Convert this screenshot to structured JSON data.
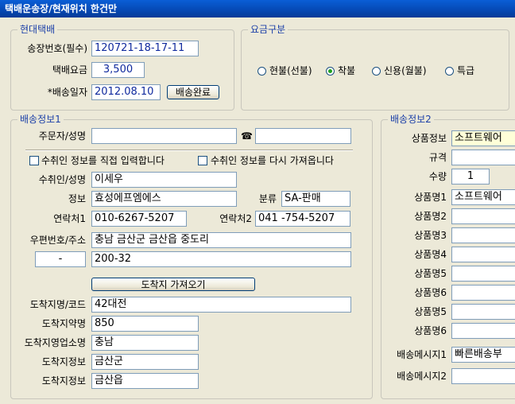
{
  "window": {
    "title": "택배운송장/현재위치 한건만"
  },
  "courier_group": {
    "title": "현대택배",
    "invoice_label": "송장번호(필수)",
    "invoice_value": "120721-18-17-11",
    "fee_label": "택배요금",
    "fee_value": "3,500",
    "date_label": "*배송일자",
    "date_value": "2012.08.10",
    "complete_button": "배송완료"
  },
  "fee_type_group": {
    "title": "요금구분",
    "options": [
      "현불(선불)",
      "착불",
      "신용(월불)",
      "특급"
    ],
    "selected": "착불"
  },
  "delivery_info1": {
    "title": "배송정보1",
    "orderer_label": "주문자/성명",
    "orderer_value": "",
    "phone_icon": "☎",
    "phone_value": "",
    "chk_direct_label": "수취인 정보를 직접 입력합니다",
    "chk_refetch_label": "수취인 정보를 다시 가져옵니다",
    "recipient_label": "수취인/성명",
    "recipient_value": "이세우",
    "info_label": "정보",
    "info_value": "효성에프엠에스",
    "class_label": "분류",
    "class_value": "SA-판매",
    "contact1_label": "연락처1",
    "contact1_value": "010-6267-5207",
    "contact2_label": "연락처2",
    "contact2_value": "041 -754-5207",
    "postal_label": "우편번호/주소",
    "postal_code": "-",
    "address1": "충남 금산군 금산읍 중도리",
    "address2": "200-32",
    "fetch_button": "도착지 가져오기",
    "dest_name_label": "도착지명/코드",
    "dest_name_value": "42대전",
    "dest_short_label": "도착지약명",
    "dest_short_value": "850",
    "dest_office_label": "도착지영업소명",
    "dest_office_value": "충남",
    "dest_info_label": "도착지정보",
    "dest_info_value": "금산군",
    "dest_info2_label": "도착지정보",
    "dest_info2_value": "금산읍"
  },
  "delivery_info2": {
    "title": "배송정보2",
    "product_info_label": "상품정보",
    "product_info_value": "소프트웨어",
    "spec_label": "규격",
    "spec_value": "",
    "qty_label": "수량",
    "qty_value": "1",
    "product_rows": [
      {
        "label": "상품명1",
        "value": "소프트웨어"
      },
      {
        "label": "상품명2",
        "value": ""
      },
      {
        "label": "상품명3",
        "value": ""
      },
      {
        "label": "상품명4",
        "value": ""
      },
      {
        "label": "상품명5",
        "value": ""
      },
      {
        "label": "상품명6",
        "value": ""
      },
      {
        "label": "상품명5",
        "value": ""
      },
      {
        "label": "상품명6",
        "value": ""
      }
    ],
    "msg1_label": "배송메시지1",
    "msg1_value": "빠른배송부",
    "msg2_label": "배송메시지2",
    "msg2_value": ""
  }
}
